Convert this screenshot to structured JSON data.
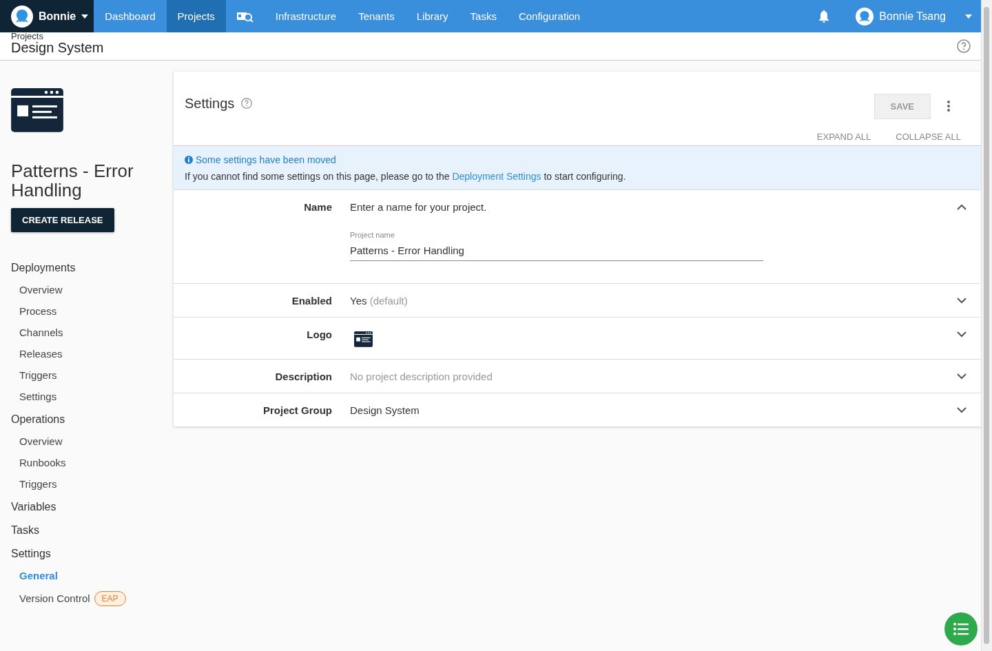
{
  "nav": {
    "space": {
      "label": "Bonnie"
    },
    "items": [
      {
        "kind": "text",
        "label": "Dashboard",
        "selected": false
      },
      {
        "kind": "text",
        "label": "Projects",
        "selected": true
      },
      {
        "kind": "icon",
        "selected": false
      },
      {
        "kind": "text",
        "label": "Infrastructure",
        "selected": false
      },
      {
        "kind": "text",
        "label": "Tenants",
        "selected": false
      },
      {
        "kind": "text",
        "label": "Library",
        "selected": false
      },
      {
        "kind": "text",
        "label": "Tasks",
        "selected": false
      },
      {
        "kind": "text",
        "label": "Configuration",
        "selected": false
      }
    ],
    "user": "Bonnie Tsang"
  },
  "header": {
    "breadcrumb": "Projects",
    "title": "Design System"
  },
  "sidebar": {
    "project_name": "Patterns - Error Handling",
    "create_button": "CREATE RELEASE",
    "sections": [
      {
        "label": "Deployments",
        "children": [
          {
            "label": "Overview",
            "selected": false
          },
          {
            "label": "Process",
            "selected": false
          },
          {
            "label": "Channels",
            "selected": false
          },
          {
            "label": "Releases",
            "selected": false
          },
          {
            "label": "Triggers",
            "selected": false
          },
          {
            "label": "Settings",
            "selected": false
          }
        ]
      },
      {
        "label": "Operations",
        "children": [
          {
            "label": "Overview",
            "selected": false
          },
          {
            "label": "Runbooks",
            "selected": false
          },
          {
            "label": "Triggers",
            "selected": false
          }
        ]
      },
      {
        "label": "Variables"
      },
      {
        "label": "Tasks"
      },
      {
        "label": "Settings",
        "children": [
          {
            "label": "General",
            "selected": true
          },
          {
            "label": "Version Control",
            "selected": false,
            "badge": "EAP"
          }
        ]
      }
    ]
  },
  "settings": {
    "title": "Settings",
    "save_button": {
      "label": "SAVE",
      "disabled": true
    },
    "expand_all": "EXPAND ALL",
    "collapse_all": "COLLAPSE ALL",
    "banner": {
      "title": "Some settings have been moved",
      "text_before": "If you cannot find some settings on this page, please go to the",
      "link": "Deployment Settings",
      "text_after": "to start configuring."
    },
    "rows": [
      {
        "kind": "field",
        "label": "Name",
        "expanded": true,
        "help": "Enter a name for your project.",
        "field_label": "Project name",
        "value": "Patterns - Error Handling"
      },
      {
        "kind": "text",
        "label": "Enabled",
        "expanded": false,
        "value": "Yes",
        "hint": "(default)"
      },
      {
        "kind": "logo",
        "label": "Logo",
        "expanded": false
      },
      {
        "kind": "muted",
        "label": "Description",
        "expanded": false,
        "value": "No project description provided"
      },
      {
        "kind": "text",
        "label": "Project Group",
        "expanded": false,
        "value": "Design System"
      }
    ]
  }
}
